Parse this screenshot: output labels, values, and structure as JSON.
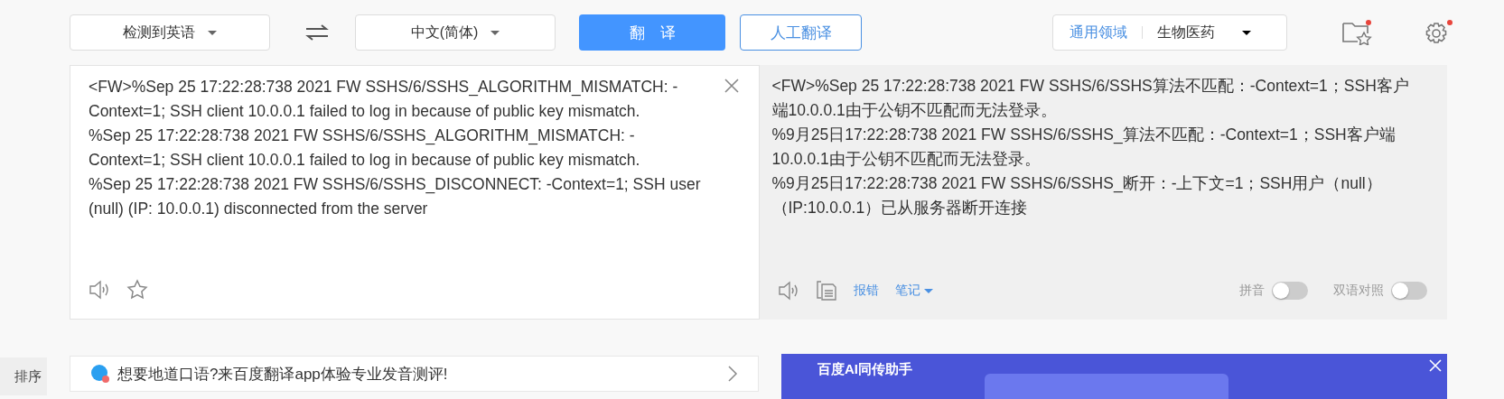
{
  "toolbar": {
    "source_language": "检测到英语",
    "target_language": "中文(简体)",
    "translate_button": "翻　译",
    "human_translate_button": "人工翻译",
    "domain": {
      "general": "通用领域",
      "selected": "生物医药"
    },
    "favorites_badge": true,
    "settings_badge": true
  },
  "source_panel": {
    "paragraphs": [
      "<FW>%Sep 25 17:22:28:738 2021 FW SSHS/6/SSHS_ALGORITHM_MISMATCH: -Context=1; SSH client 10.0.0.1 failed to log in because of public key mismatch.",
      "%Sep 25 17:22:28:738 2021 FW SSHS/6/SSHS_ALGORITHM_MISMATCH: -Context=1; SSH client 10.0.0.1 failed to log in because of public key mismatch.",
      "%Sep 25 17:22:28:738 2021 FW SSHS/6/SSHS_DISCONNECT: -Context=1; SSH user (null) (IP: 10.0.0.1) disconnected from the server"
    ]
  },
  "result_panel": {
    "paragraphs": [
      "<FW>%Sep 25 17:22:28:738 2021 FW SSHS/6/SSHS算法不匹配：-Context=1；SSH客户端10.0.0.1由于公钥不匹配而无法登录。",
      "%9月25日17:22:28:738 2021 FW SSHS/6/SSHS_算法不匹配：-Context=1；SSH客户端10.0.0.1由于公钥不匹配而无法登录。",
      "%9月25日17:22:28:738 2021 FW SSHS/6/SSHS_断开：-上下文=1；SSH用户（null）（IP:10.0.0.1）已从服务器断开连接"
    ],
    "report_link": "报错",
    "notes_link": "笔记",
    "toggles": [
      {
        "label": "拼音",
        "on": false
      },
      {
        "label": "双语对照",
        "on": false
      }
    ]
  },
  "sort_tab": "排序",
  "promo_banner": {
    "text": "想要地道口语?来百度翻译app体验专业发音测评!"
  },
  "ad_banner": {
    "brand": "百度AI同传助手"
  }
}
